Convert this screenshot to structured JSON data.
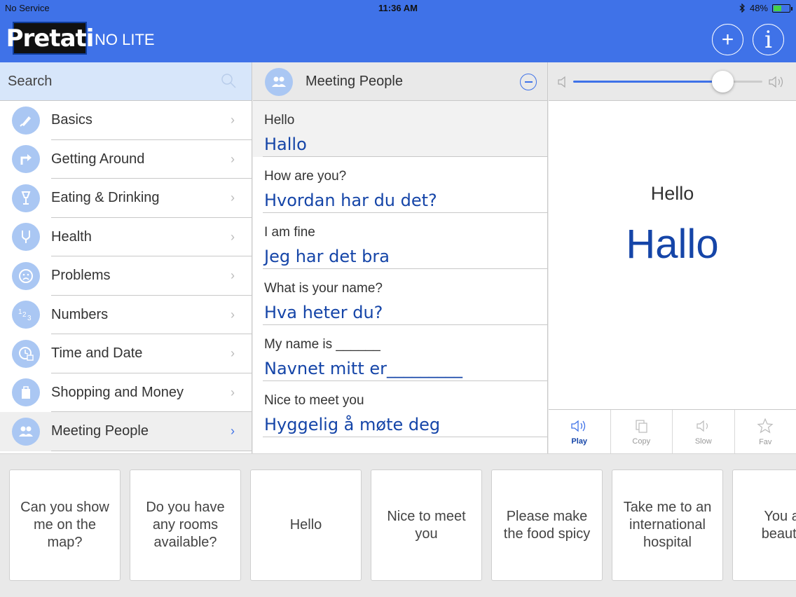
{
  "status": {
    "carrier": "No Service",
    "time": "11:36 AM",
    "battery": "48%",
    "battery_level": 0.48
  },
  "header": {
    "logo": "Pretati",
    "subtitle": "NO LITE"
  },
  "search": {
    "placeholder": "Search"
  },
  "categories": [
    {
      "label": "Basics",
      "icon": "brush-icon"
    },
    {
      "label": "Getting Around",
      "icon": "turn-arrow-icon"
    },
    {
      "label": "Eating & Drinking",
      "icon": "glass-icon"
    },
    {
      "label": "Health",
      "icon": "stethoscope-icon"
    },
    {
      "label": "Problems",
      "icon": "sad-face-icon"
    },
    {
      "label": "Numbers",
      "icon": "numbers-icon"
    },
    {
      "label": "Time and Date",
      "icon": "clock-icon"
    },
    {
      "label": "Shopping and Money",
      "icon": "shopping-bag-icon"
    },
    {
      "label": "Meeting People",
      "icon": "people-icon"
    }
  ],
  "middle": {
    "title": "Meeting People",
    "phrases": [
      {
        "en": "Hello",
        "no": "Hallo"
      },
      {
        "en": "How are you?",
        "no": "Hvordan har du det?"
      },
      {
        "en": "I am fine",
        "no": "Jeg har det bra"
      },
      {
        "en": "What is your name?",
        "no": "Hva heter du?"
      },
      {
        "en": "My name is ______",
        "no": "Navnet mitt er_________"
      },
      {
        "en": "Nice to meet you",
        "no": "Hyggelig å møte deg"
      }
    ]
  },
  "detail": {
    "english": "Hello",
    "translation": "Hallo",
    "volume": 0.79,
    "actions": {
      "play": "Play",
      "copy": "Copy",
      "slow": "Slow",
      "fav": "Fav"
    }
  },
  "cards": [
    "Can you show me on the map?",
    "Do you have any rooms available?",
    "Hello",
    "Nice to meet you",
    "Please make the food spicy",
    "Take me to an international hospital",
    "You are beautiful"
  ],
  "colors": {
    "accent": "#3f72e8",
    "translation": "#1545a8",
    "icon_bg": "#aac7f3"
  }
}
